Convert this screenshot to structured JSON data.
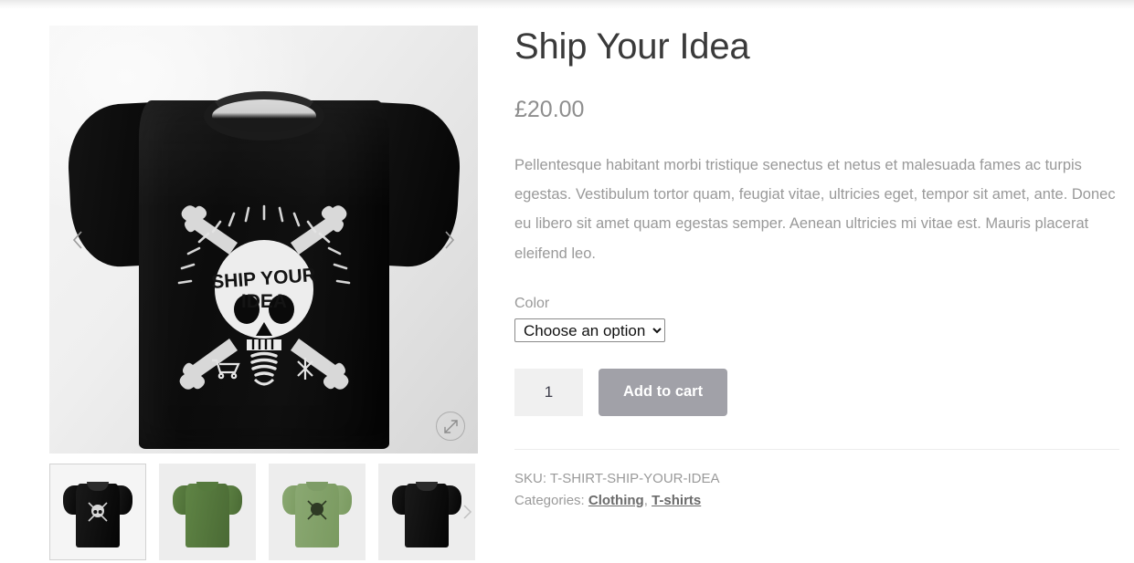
{
  "product": {
    "title": "Ship Your Idea",
    "price": "£20.00",
    "description": "Pellentesque habitant morbi tristique senectus et netus et malesuada fames ac turpis egestas. Vestibulum tortor quam, feugiat vitae, ultricies eget, tempor sit amet, ante. Donec eu libero sit amet quam egestas semper. Aenean ultricies mi vitae est. Mauris placerat eleifend leo."
  },
  "variation": {
    "attribute_label": "Color",
    "selected_option": "Choose an option",
    "options": [
      "Choose an option"
    ]
  },
  "cart": {
    "quantity": "1",
    "quantity_placeholder": "1",
    "add_to_cart_label": "Add to cart"
  },
  "meta": {
    "sku_label": "SKU:",
    "sku_value": "T-SHIRT-SHIP-YOUR-IDEA",
    "categories_label": "Categories:",
    "categories": [
      "Clothing",
      "T-shirts"
    ],
    "categories_separator": ", "
  },
  "gallery": {
    "main_image_alt": "Black t-shirt with Ship Your Idea skull lightbulb print",
    "prev_icon": "chevron-left-icon",
    "next_icon": "chevron-right-icon",
    "zoom_icon": "expand-arrows-icon",
    "print_text_line1": "SHIP YOUR",
    "print_text_line2": "IDEA",
    "thumbnails": [
      {
        "alt": "Black t-shirt front with skull print",
        "color": "t-black",
        "active": true
      },
      {
        "alt": "Green t-shirt back",
        "color": "t-green",
        "active": false
      },
      {
        "alt": "Green t-shirt front with skull print",
        "color": "t-greenlt",
        "active": false
      },
      {
        "alt": "Black t-shirt back",
        "color": "t-black",
        "active": false
      }
    ],
    "thumbs_next_icon": "chevron-right-icon"
  },
  "colors": {
    "title": "#3a3a3a",
    "price": "#8e8e8e",
    "body_text": "#999999",
    "button": "#a1a1a8",
    "button_text": "#ffffff",
    "qty_bg": "#f0f0f0",
    "link": "#6b6b6b",
    "divider": "#ededed"
  }
}
